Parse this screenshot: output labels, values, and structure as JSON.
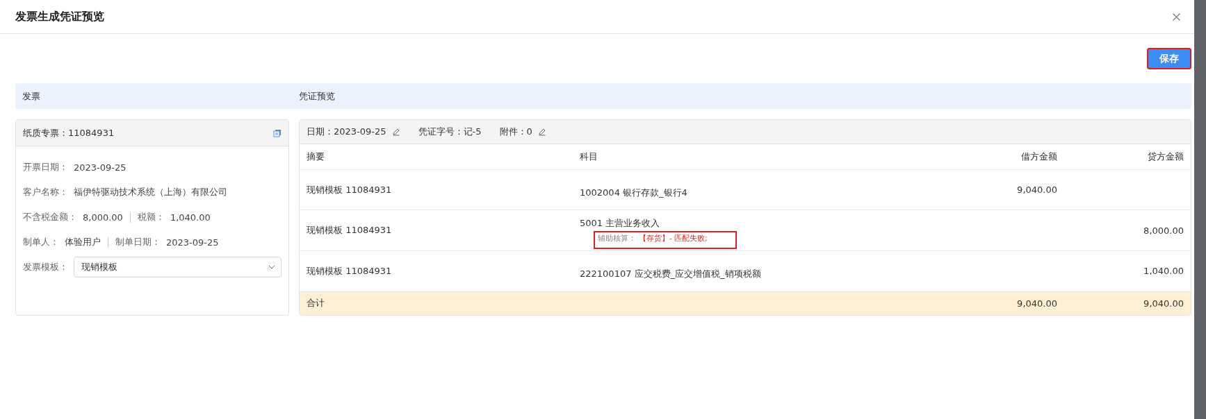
{
  "dialog": {
    "title": "发票生成凭证预览",
    "save_button": {
      "label": "保存",
      "highlighted": true
    }
  },
  "section_headers": [
    "发票",
    "凭证预览"
  ],
  "invoice": {
    "title": "纸质专票：11084931",
    "fields": [
      {
        "label": "开票日期：",
        "value": "2023-09-25"
      },
      {
        "label": "客户名称：",
        "value": "福伊特驱动技术系统（上海）有限公司"
      }
    ],
    "pairs": [
      [
        {
          "label": "不含税金额：",
          "value": "8,000.00"
        },
        {
          "label": "税额：",
          "value": "1,040.00"
        }
      ],
      [
        {
          "label": "制单人：",
          "value": "体验用户"
        },
        {
          "label": "制单日期：",
          "value": "2023-09-25"
        }
      ]
    ],
    "template": {
      "label": "发票模板：",
      "value": "现销模板"
    }
  },
  "voucher": {
    "meta": [
      {
        "label": "日期：",
        "value": "2023-09-25",
        "editable": true
      },
      {
        "label": "凭证字号：",
        "value": "记-5",
        "editable": false
      },
      {
        "label": "附件：",
        "value": "0",
        "editable": true
      }
    ],
    "columns": [
      "摘要",
      "科目",
      "借方金额",
      "贷方金额"
    ],
    "rows": [
      {
        "summary": "现销模板 11084931",
        "account": "1002004 银行存款_银行4",
        "debit": "9,040.00",
        "credit": ""
      },
      {
        "summary": "现销模板 11084931",
        "account": "5001 主营业务收入",
        "aux_label": "辅助核算：",
        "aux_error": "【存货】- 匹配失败;",
        "aux_highlighted": true,
        "debit": "",
        "credit": "8,000.00"
      },
      {
        "summary": "现销模板 11084931",
        "account": "222100107 应交税费_应交增值税_销项税额",
        "debit": "",
        "credit": "1,040.00"
      }
    ],
    "total": {
      "label": "合计",
      "debit": "9,040.00",
      "credit": "9,040.00"
    }
  }
}
